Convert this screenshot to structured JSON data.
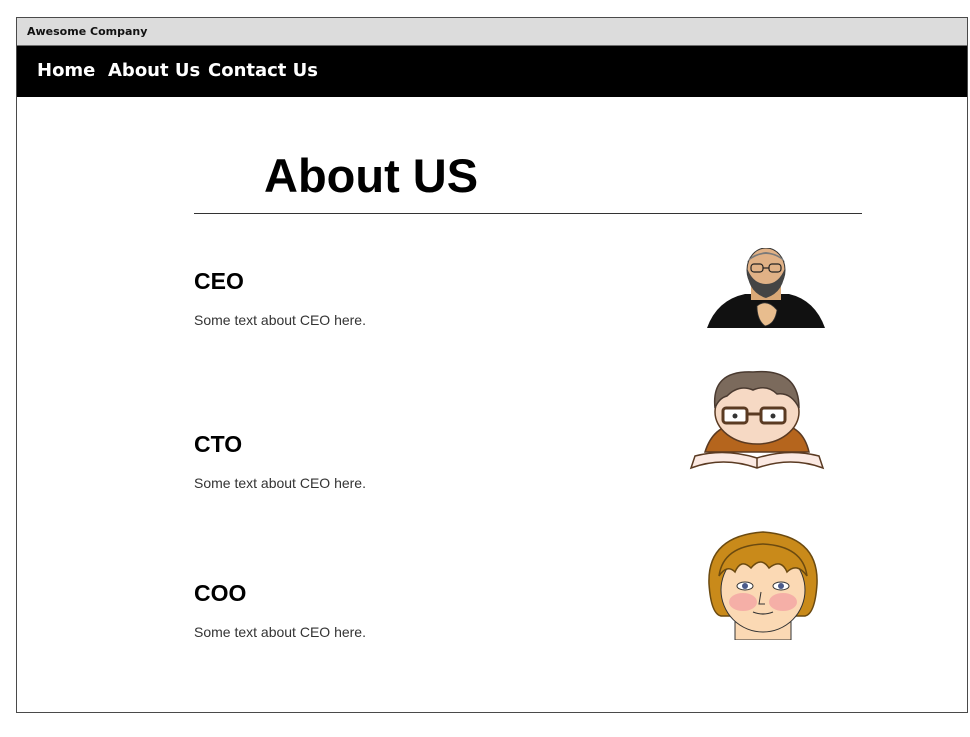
{
  "window": {
    "title": "Awesome Company"
  },
  "nav": {
    "items": [
      "Home",
      "About Us",
      "Contact Us"
    ]
  },
  "page": {
    "title": "About US"
  },
  "team": [
    {
      "role": "CEO",
      "text": "Some text about CEO here.",
      "avatar": "bearded-man-icon"
    },
    {
      "role": "CTO",
      "text": "Some text about CEO here.",
      "avatar": "boy-reading-book-icon"
    },
    {
      "role": "COO",
      "text": "Some text about CEO here.",
      "avatar": "blushing-boy-face-icon"
    }
  ]
}
